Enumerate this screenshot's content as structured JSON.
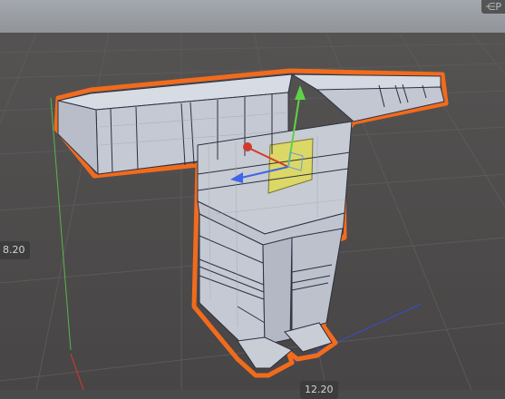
{
  "viewport": {
    "dimension_height_label": "8.20",
    "dimension_width_label": "12.20",
    "scene_orientation_glyph": "⋲",
    "orientation_widget_label": "P"
  },
  "colors": {
    "sky": "#999ea4",
    "ground": "#4a4847",
    "grid": "#5c5a58",
    "mesh_face": "#c6cad3",
    "mesh_face_dark": "#a9aebb",
    "mesh_face_light": "#d8dce3",
    "selection_outline": "#f26b1d",
    "selected_face": "#d9d66a",
    "axis_x": "#d33a2c",
    "axis_y": "#5fd24a",
    "axis_z": "#3f66e6",
    "guide_red": "#c13a30",
    "guide_green": "#56b84a",
    "guide_blue": "#3a4cc8"
  },
  "icons": {
    "gizmo": "move-gizmo-icon"
  }
}
